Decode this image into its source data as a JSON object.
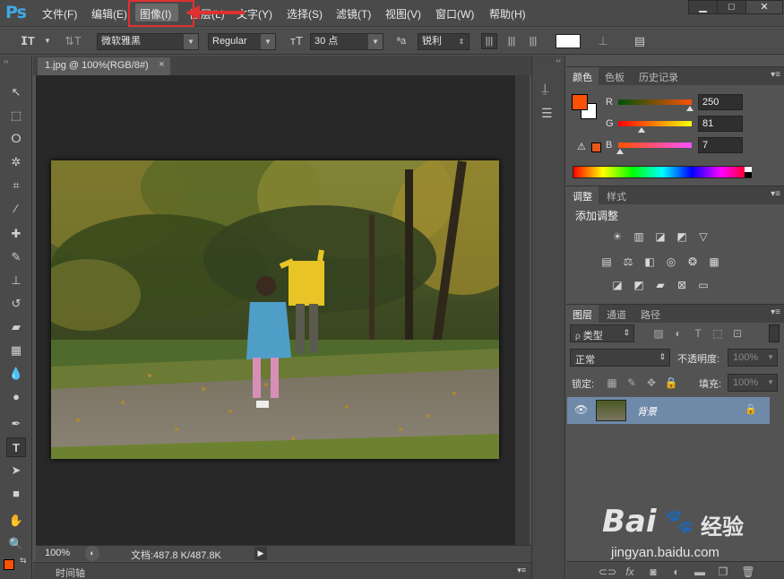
{
  "app": {
    "logo": "Ps"
  },
  "menu": {
    "items": [
      "文件(F)",
      "编辑(E)",
      "图像(I)",
      "图层(L)",
      "文字(Y)",
      "选择(S)",
      "滤镜(T)",
      "视图(V)",
      "窗口(W)",
      "帮助(H)"
    ]
  },
  "window_controls": {
    "minimize": "▁",
    "maximize": "□",
    "close": "✕"
  },
  "options": {
    "font_family": "微软雅黑",
    "font_style": "Regular",
    "font_size": "30 点",
    "aa_label": "ªa",
    "antialias": "锐利"
  },
  "document": {
    "tab_title": "1.jpg @ 100%(RGB/8#)",
    "tab_close": "×",
    "zoom": "100%",
    "doc_info": "文档:487.8 K/487.8K",
    "timeline_tab": "时间轴"
  },
  "color_panel": {
    "tabs": [
      "颜色",
      "色板",
      "历史记录"
    ],
    "channels": [
      {
        "label": "R",
        "value": "250",
        "fraction": 0.98
      },
      {
        "label": "G",
        "value": "81",
        "fraction": 0.32
      },
      {
        "label": "B",
        "value": "7",
        "fraction": 0.03
      }
    ],
    "foreground": "#fa5107",
    "background": "#ffffff"
  },
  "adjust_panel": {
    "tabs": [
      "调整",
      "样式"
    ],
    "title": "添加调整"
  },
  "layers_panel": {
    "tabs": [
      "图层",
      "通道",
      "路径"
    ],
    "filter_kind": "类型",
    "blend_mode": "正常",
    "opacity_label": "不透明度:",
    "opacity_value": "100%",
    "lock_label": "锁定:",
    "fill_label": "填充:",
    "fill_value": "100%",
    "layers": [
      {
        "name": "背景",
        "visible": true,
        "locked": true
      }
    ]
  },
  "watermark": {
    "brand": "Bai",
    "brand_cn": "经验",
    "url": "jingyan.baidu.com"
  },
  "colors": {
    "accent": "#3fa9e6",
    "highlight": "#e03030",
    "selection": "#6f8aa8"
  }
}
